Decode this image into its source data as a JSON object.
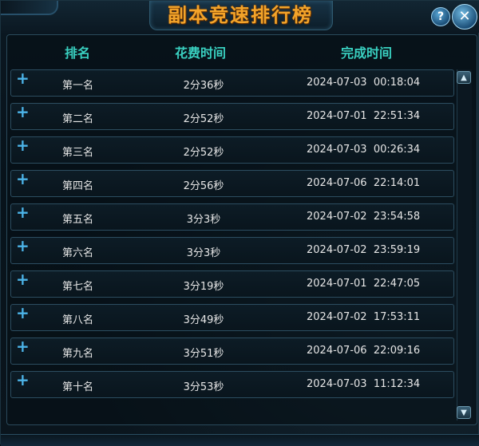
{
  "window": {
    "title": "副本竞速排行榜",
    "help_glyph": "?",
    "close_glyph": "✕"
  },
  "table": {
    "headers": {
      "rank": "排名",
      "time": "花费时间",
      "completed": "完成时间"
    },
    "expand_glyph": "+",
    "rows": [
      {
        "rank": "第一名",
        "time": "2分36秒",
        "completed": "2024-07-03  00:18:04"
      },
      {
        "rank": "第二名",
        "time": "2分52秒",
        "completed": "2024-07-01  22:51:34"
      },
      {
        "rank": "第三名",
        "time": "2分52秒",
        "completed": "2024-07-03  00:26:34"
      },
      {
        "rank": "第四名",
        "time": "2分56秒",
        "completed": "2024-07-06  22:14:01"
      },
      {
        "rank": "第五名",
        "time": "3分3秒",
        "completed": "2024-07-02  23:54:58"
      },
      {
        "rank": "第六名",
        "time": "3分3秒",
        "completed": "2024-07-02  23:59:19"
      },
      {
        "rank": "第七名",
        "time": "3分19秒",
        "completed": "2024-07-01  22:47:05"
      },
      {
        "rank": "第八名",
        "time": "3分49秒",
        "completed": "2024-07-02  17:53:11"
      },
      {
        "rank": "第九名",
        "time": "3分51秒",
        "completed": "2024-07-06  22:09:16"
      },
      {
        "rank": "第十名",
        "time": "3分53秒",
        "completed": "2024-07-03  11:12:34"
      }
    ]
  },
  "scrollbar": {
    "up_glyph": "▲",
    "down_glyph": "▼"
  },
  "colors": {
    "title": "#f3a42a",
    "header": "#39d0c0",
    "expand_icon": "#4cb4e8",
    "row_text": "#e6e6e6"
  }
}
